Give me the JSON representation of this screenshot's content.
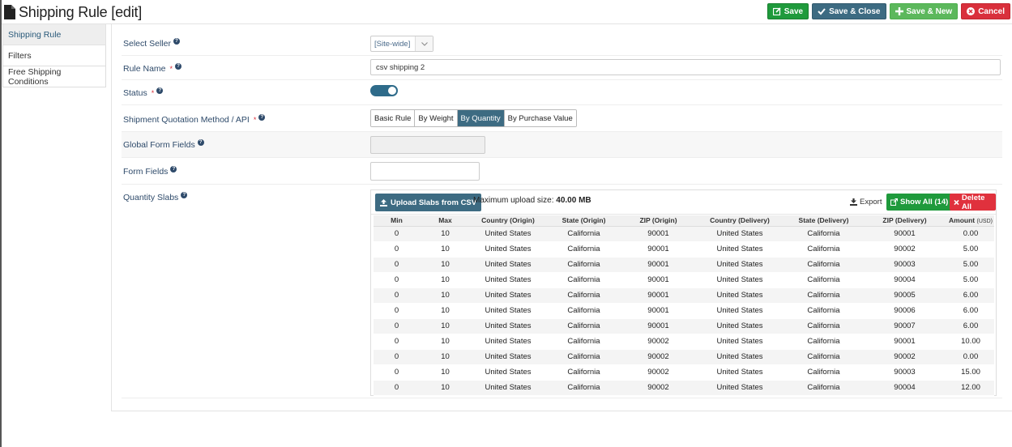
{
  "page": {
    "title": "Shipping Rule [edit]"
  },
  "toolbar": {
    "save_label": "Save",
    "save_close_label": "Save & Close",
    "save_new_label": "Save & New",
    "cancel_label": "Cancel",
    "colors": {
      "save": "#1f9a3c",
      "save_close": "#3d6b82",
      "save_new": "#5cb85c",
      "cancel": "#d9303c"
    }
  },
  "sidebar": {
    "items": [
      {
        "label": "Shipping Rule",
        "active": true
      },
      {
        "label": "Filters",
        "active": false
      },
      {
        "label": "Free Shipping Conditions",
        "active": false
      }
    ]
  },
  "form": {
    "select_seller": {
      "label": "Select Seller",
      "value": "[Site-wide]"
    },
    "rule_name": {
      "label": "Rule Name",
      "required_mark": "*",
      "value": "csv shipping 2"
    },
    "status": {
      "label": "Status",
      "required_mark": "*",
      "enabled": true
    },
    "quotation_method": {
      "label": "Shipment Quotation Method / API",
      "required_mark": "*",
      "options": [
        "Basic Rule",
        "By Weight",
        "By Quantity",
        "By Purchase Value"
      ],
      "selected": "By Quantity"
    },
    "global_form_fields": {
      "label": "Global Form Fields"
    },
    "form_fields": {
      "label": "Form Fields"
    },
    "quantity_slabs": {
      "label": "Quantity Slabs"
    }
  },
  "slabs": {
    "upload_label": "Upload Slabs from CSV",
    "max_upload_text": "Maximum upload size:",
    "max_upload_value": "40.00 MB",
    "export_label": "Export",
    "show_all_label": "Show All (14)",
    "delete_all_label": "Delete All",
    "columns": [
      "Min",
      "Max",
      "Country (Origin)",
      "State (Origin)",
      "ZIP (Origin)",
      "Country (Delivery)",
      "State (Delivery)",
      "ZIP (Delivery)",
      "Amount"
    ],
    "amount_unit": "(USD)",
    "rows": [
      [
        "0",
        "10",
        "United States",
        "California",
        "90001",
        "United States",
        "California",
        "90001",
        "0.00"
      ],
      [
        "0",
        "10",
        "United States",
        "California",
        "90001",
        "United States",
        "California",
        "90002",
        "5.00"
      ],
      [
        "0",
        "10",
        "United States",
        "California",
        "90001",
        "United States",
        "California",
        "90003",
        "5.00"
      ],
      [
        "0",
        "10",
        "United States",
        "California",
        "90001",
        "United States",
        "California",
        "90004",
        "5.00"
      ],
      [
        "0",
        "10",
        "United States",
        "California",
        "90001",
        "United States",
        "California",
        "90005",
        "6.00"
      ],
      [
        "0",
        "10",
        "United States",
        "California",
        "90001",
        "United States",
        "California",
        "90006",
        "6.00"
      ],
      [
        "0",
        "10",
        "United States",
        "California",
        "90001",
        "United States",
        "California",
        "90007",
        "6.00"
      ],
      [
        "0",
        "10",
        "United States",
        "California",
        "90002",
        "United States",
        "California",
        "90001",
        "10.00"
      ],
      [
        "0",
        "10",
        "United States",
        "California",
        "90002",
        "United States",
        "California",
        "90002",
        "0.00"
      ],
      [
        "0",
        "10",
        "United States",
        "California",
        "90002",
        "United States",
        "California",
        "90003",
        "15.00"
      ],
      [
        "0",
        "10",
        "United States",
        "California",
        "90002",
        "United States",
        "California",
        "90004",
        "12.00"
      ]
    ]
  }
}
